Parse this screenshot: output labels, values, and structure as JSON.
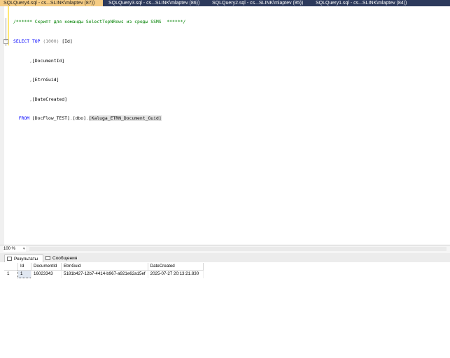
{
  "tabs": [
    {
      "label": "SQLQuery4.sql - cs...SLINK\\mlaptev (87))"
    },
    {
      "label": "SQLQuery3.sql - cs...SLINK\\mlaptev (86))"
    },
    {
      "label": "SQLQuery2.sql - cs...SLINK\\mlaptev (85))"
    },
    {
      "label": "SQLQuery1.sql - cs...SLINK\\mlaptev (84))"
    }
  ],
  "editor": {
    "comment": "/****** Скрипт для команды SelectTopNRows из среды SSMS  ******/",
    "select_kw": "SELECT",
    "top_kw": "TOP",
    "top_value": "(1000)",
    "col_id": "[Id]",
    "comma": ",",
    "col_documentid": "[DocumentId]",
    "col_etrnguid": "[EtrnGuid]",
    "col_datecreated": "[DateCreated]",
    "from_kw": "FROM",
    "db": "[DocFlow_TEST]",
    "dot": ".",
    "schema": "[dbo]",
    "table": "[Kaluga_ETRN_Document_Guid]",
    "fold_symbol": "−"
  },
  "status": {
    "zoom": "100 %",
    "zoom_arrow": "▾"
  },
  "results_tabs": [
    {
      "label": "Результаты",
      "icon": "grid-icon"
    },
    {
      "label": "Сообщения",
      "icon": "messages-icon"
    }
  ],
  "grid": {
    "columns": [
      "Id",
      "DocumentId",
      "EtrnGuid",
      "DateCreated"
    ],
    "rows": [
      {
        "rownum": "1",
        "Id": "1",
        "DocumentId": "16023343",
        "EtrnGuid": "5181b427-12b7-4414-b967-a921e62a15ef",
        "DateCreated": "2025-07-27 20:13:21.830"
      }
    ]
  }
}
